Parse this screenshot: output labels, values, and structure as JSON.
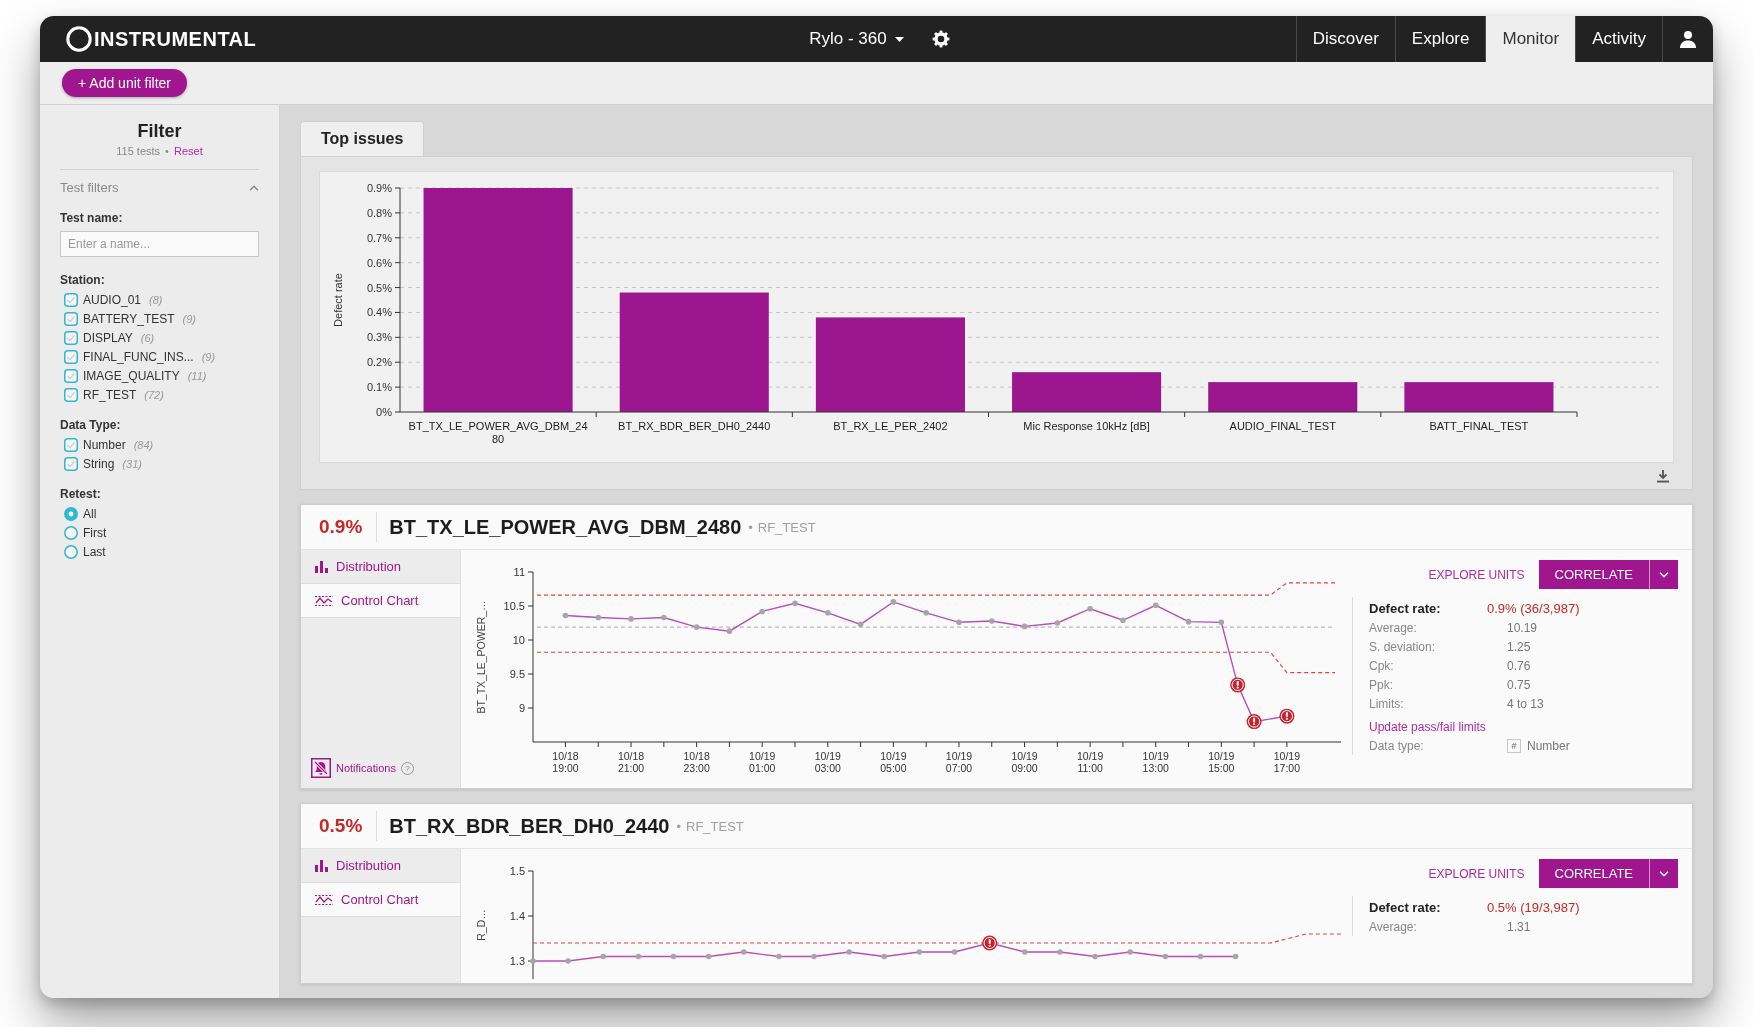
{
  "header": {
    "logo": "INSTRUMENTAL",
    "project": "Rylo - 360",
    "nav": [
      {
        "label": "Discover",
        "selected": false
      },
      {
        "label": "Explore",
        "selected": false
      },
      {
        "label": "Monitor",
        "selected": true
      },
      {
        "label": "Activity",
        "selected": false
      }
    ]
  },
  "toolbar": {
    "add_filter_button": "+ Add unit filter"
  },
  "filter": {
    "title": "Filter",
    "count": "115 tests",
    "separator": "•",
    "reset": "Reset",
    "section": {
      "label": "Test filters",
      "expanded": true
    },
    "test_name": {
      "label": "Test name:",
      "placeholder": "Enter a name..."
    },
    "groups": [
      {
        "label": "Station:",
        "kind": "checkbox",
        "options": [
          {
            "name": "AUDIO_01",
            "count": "(8)",
            "checked": false
          },
          {
            "name": "BATTERY_TEST",
            "count": "(9)",
            "checked": false
          },
          {
            "name": "DISPLAY",
            "count": "(6)",
            "checked": false
          },
          {
            "name": "FINAL_FUNC_INS...",
            "count": "(9)",
            "checked": false
          },
          {
            "name": "IMAGE_QUALITY",
            "count": "(11)",
            "checked": false
          },
          {
            "name": "RF_TEST",
            "count": "(72)",
            "checked": false
          }
        ]
      },
      {
        "label": "Data Type:",
        "kind": "checkbox",
        "options": [
          {
            "name": "Number",
            "count": "(84)",
            "checked": false
          },
          {
            "name": "String",
            "count": "(31)",
            "checked": false
          }
        ]
      },
      {
        "label": "Retest:",
        "kind": "radio",
        "options": [
          {
            "name": "All",
            "selected": true
          },
          {
            "name": "First",
            "selected": false
          },
          {
            "name": "Last",
            "selected": false
          }
        ]
      }
    ]
  },
  "top_issues": {
    "tab": "Top issues",
    "chart_data": {
      "type": "bar",
      "ylabel": "Defect rate",
      "grid": true,
      "categories": [
        "BT_TX_LE_POWER_AVG_DBM_2480",
        "BT_RX_BDR_BER_DH0_2440",
        "BT_RX_LE_PER_2402",
        "Mic Response 10kHz [dB]",
        "AUDIO_FINAL_TEST",
        "BATT_FINAL_TEST"
      ],
      "series": [
        {
          "color": "#9c168f",
          "values": [
            0.9,
            0.48,
            0.38,
            0.16,
            0.12,
            0.12
          ]
        }
      ],
      "ylim": [
        0,
        0.9
      ],
      "yticks": [
        {
          "value": 0,
          "label": "0%"
        },
        {
          "value": 0.1,
          "label": "0.1%"
        },
        {
          "value": 0.2,
          "label": "0.2%"
        },
        {
          "value": 0.3,
          "label": "0.3%"
        },
        {
          "value": 0.4,
          "label": "0.4%"
        },
        {
          "value": 0.5,
          "label": "0.5%"
        },
        {
          "value": 0.6,
          "label": "0.6%"
        },
        {
          "value": 0.7,
          "label": "0.7%"
        },
        {
          "value": 0.8,
          "label": "0.8%"
        },
        {
          "value": 0.9,
          "label": "0.9%"
        }
      ]
    }
  },
  "tests": [
    {
      "rate": "0.9%",
      "name": "BT_TX_LE_POWER_AVG_DBM_2480",
      "separator": "•",
      "station": "RF_TEST",
      "views": [
        {
          "label": "Distribution",
          "kind": "distribution",
          "selected": false
        },
        {
          "label": "Control Chart",
          "kind": "control",
          "selected": true
        }
      ],
      "notifications": {
        "label": "Notifications",
        "help": "?"
      },
      "chart_data": {
        "type": "line",
        "ylabel": "BT_TX_LE_POWER_…",
        "categories": [
          "10/18 19:00",
          null,
          null,
          null,
          "10/18 21:00",
          null,
          null,
          null,
          "10/18 23:00",
          null,
          null,
          null,
          "10/19 01:00",
          null,
          null,
          null,
          "10/19 03:00",
          null,
          null,
          null,
          "10/19 05:00",
          null,
          null,
          null,
          "10/19 07:00",
          null,
          null,
          null,
          "10/19 09:00",
          null,
          null,
          null,
          "10/19 11:00",
          null,
          null,
          null,
          "10/19 13:00",
          null,
          null,
          null,
          "10/19 15:00",
          null,
          null,
          null,
          "10/19 17:00"
        ],
        "ylim": [
          8.5,
          11
        ],
        "yticks": [
          9,
          9.5,
          10,
          10.5,
          11
        ],
        "series": [
          {
            "color": "#e0443c",
            "line_style": "dashed",
            "values": [
              10.66,
              10.66,
              10.66,
              10.66,
              10.66,
              10.66,
              10.66,
              10.66,
              10.66,
              10.66,
              10.66,
              10.66,
              10.66,
              10.66,
              10.66,
              10.66,
              10.66,
              10.66,
              10.66,
              10.66,
              10.66,
              10.66,
              10.66,
              10.66,
              10.66,
              10.66,
              10.66,
              10.66,
              10.66,
              10.66,
              10.66,
              10.66,
              10.66,
              10.66,
              10.66,
              10.66,
              10.66,
              10.66,
              10.66,
              10.66,
              10.66,
              10.66,
              10.66,
              10.66,
              10.84
            ]
          },
          {
            "color": "#b9b9b9",
            "line_style": "dashed",
            "values": [
              10.19,
              10.19,
              10.19,
              10.19,
              10.19,
              10.19,
              10.19,
              10.19,
              10.19,
              10.19,
              10.19,
              10.19,
              10.19,
              10.19,
              10.19,
              10.19,
              10.19,
              10.19,
              10.19,
              10.19,
              10.19,
              10.19,
              10.19,
              10.19,
              10.19,
              10.19,
              10.19,
              10.19,
              10.19,
              10.19,
              10.19,
              10.19,
              10.19,
              10.19,
              10.19,
              10.19,
              10.19,
              10.19,
              10.19,
              10.19,
              10.19,
              10.19,
              10.19,
              10.19,
              10.19
            ]
          },
          {
            "color": "#e0443c",
            "line_style": "dashed",
            "values": [
              9.82,
              9.82,
              9.82,
              9.82,
              9.82,
              9.82,
              9.82,
              9.82,
              9.82,
              9.82,
              9.82,
              9.82,
              9.82,
              9.82,
              9.82,
              9.82,
              9.82,
              9.82,
              9.82,
              9.82,
              9.82,
              9.82,
              9.82,
              9.82,
              9.82,
              9.82,
              9.82,
              9.82,
              9.82,
              9.82,
              9.82,
              9.82,
              9.82,
              9.82,
              9.82,
              9.82,
              9.82,
              9.82,
              9.82,
              9.82,
              9.82,
              9.82,
              9.82,
              9.82,
              9.52
            ]
          },
          {
            "color": "#b84dbf",
            "line_style": "solid",
            "values": [
              10.36,
              null,
              10.33,
              null,
              10.31,
              null,
              10.33,
              null,
              10.19,
              null,
              10.13,
              null,
              10.42,
              null,
              10.54,
              null,
              10.4,
              null,
              10.23,
              null,
              10.56,
              null,
              10.4,
              null,
              10.26,
              null,
              10.28,
              null,
              10.2,
              null,
              10.25,
              null,
              10.46,
              null,
              10.29,
              null,
              10.51,
              null,
              10.27,
              null,
              10.26,
              9.34,
              8.8,
              null,
              8.88
            ]
          },
          {
            "type": "scatter",
            "marker": "circle",
            "color": "#c8232c",
            "values": [
              null,
              null,
              null,
              null,
              null,
              null,
              null,
              null,
              null,
              null,
              null,
              null,
              null,
              null,
              null,
              null,
              null,
              null,
              null,
              null,
              null,
              null,
              null,
              null,
              null,
              null,
              null,
              null,
              null,
              null,
              null,
              null,
              null,
              null,
              null,
              null,
              null,
              null,
              null,
              null,
              null,
              9.34,
              8.8,
              null,
              8.88
            ]
          }
        ]
      },
      "explore": "EXPLORE UNITS",
      "correlate": "CORRELATE",
      "defect_rate": {
        "label": "Defect rate:",
        "value": "0.9% (36/3,987)"
      },
      "stats": [
        {
          "label": "Average:",
          "value": "10.19"
        },
        {
          "label": "S. deviation:",
          "value": "1.25"
        },
        {
          "label": "Cpk:",
          "value": "0.76"
        },
        {
          "label": "Ppk:",
          "value": "0.75"
        },
        {
          "label": "Limits:",
          "value": "4 to 13"
        }
      ],
      "update_limits": "Update pass/fail limits",
      "data_type": {
        "label": "Data type:",
        "icon": "#",
        "value": "Number"
      }
    },
    {
      "rate": "0.5%",
      "name": "BT_RX_BDR_BER_DH0_2440",
      "separator": "•",
      "station": "RF_TEST",
      "views": [
        {
          "label": "Distribution",
          "kind": "distribution",
          "selected": false
        },
        {
          "label": "Control Chart",
          "kind": "control",
          "selected": true
        }
      ],
      "chart_data": {
        "type": "line",
        "ylabel": "R_D…",
        "categories": [
          null,
          null,
          null,
          null,
          null,
          null,
          null,
          null,
          null,
          null,
          null,
          null,
          null,
          null,
          null,
          null,
          null,
          null,
          null,
          null,
          null,
          null,
          null,
          null
        ],
        "ylim": [
          1.26,
          1.5
        ],
        "yticks": [
          1.3,
          1.4,
          1.5
        ],
        "series": [
          {
            "color": "#e0443c",
            "line_style": "dashed",
            "values": [
              1.34,
              1.34,
              1.34,
              1.34,
              1.34,
              1.34,
              1.34,
              1.34,
              1.34,
              1.34,
              1.34,
              1.34,
              1.34,
              1.34,
              1.34,
              1.34,
              1.34,
              1.34,
              1.34,
              1.34,
              1.34,
              1.34,
              1.36,
              1.36
            ]
          },
          {
            "color": "#b84dbf",
            "line_style": "solid",
            "values": [
              1.3,
              1.3,
              1.31,
              1.31,
              1.31,
              1.31,
              1.32,
              1.31,
              1.31,
              1.32,
              1.31,
              1.32,
              1.32,
              1.34,
              1.32,
              1.32,
              1.31,
              1.32,
              1.31,
              1.31,
              1.31,
              null,
              null,
              null
            ]
          },
          {
            "type": "scatter",
            "marker": "circle",
            "color": "#c8232c",
            "values": [
              null,
              null,
              null,
              null,
              null,
              null,
              null,
              null,
              null,
              null,
              null,
              null,
              null,
              1.34,
              null,
              null,
              null,
              null,
              null,
              null,
              null,
              null,
              null,
              null
            ]
          }
        ]
      },
      "explore": "EXPLORE UNITS",
      "correlate": "CORRELATE",
      "defect_rate": {
        "label": "Defect rate:",
        "value": "0.5% (19/3,987)"
      },
      "stats": [
        {
          "label": "Average:",
          "value": "1.31"
        }
      ]
    }
  ]
}
